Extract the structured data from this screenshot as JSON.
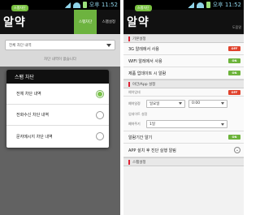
{
  "status": {
    "time_left": "오후 11:52",
    "time_right": "오후 11:52"
  },
  "left": {
    "app": {
      "badge": "스팸차단",
      "logo": "알약"
    },
    "tabs": [
      {
        "label": "스팸차단"
      },
      {
        "label": "스팸설정"
      }
    ],
    "dropdown": {
      "value": "전체 차단 내역"
    },
    "list_label": "차단 내역이 없습니다",
    "dialog": {
      "title": "스팸 차단",
      "items": [
        {
          "label": "전체 차단 내역",
          "selected": true
        },
        {
          "label": "전화수신 차단 내역",
          "selected": false
        },
        {
          "label": "문자메시지 차단 내역",
          "selected": false
        }
      ]
    }
  },
  "right": {
    "app": {
      "badge": "스팸차단",
      "logo": "알약",
      "help": "도움말"
    },
    "sections": {
      "s1": "기본설정",
      "s2": "야간/App 설정",
      "s3": "스팸설정"
    },
    "rows": {
      "r1": {
        "label": "3G 알레에서 사용",
        "toggle": "OFF"
      },
      "r2": {
        "label": "WIFI 알레에서 사용",
        "toggle": "ON"
      },
      "r3": {
        "label": "제품 업데이트 시 알람",
        "toggle": "ON"
      },
      "r4": {
        "label": "예약업데",
        "toggle": "OFF"
      },
      "r5": {
        "label": "알람기간 알기",
        "toggle": "ON"
      },
      "r6": {
        "label": "APP 설치 후 진단 실행 알림"
      }
    },
    "schedule": {
      "day_label": "예약일정",
      "day_value": "일요일",
      "time_value": "0:00",
      "cycle_small": "업데이트 설정",
      "cycle_label": "예약주기",
      "cycle_value": "1일"
    }
  }
}
